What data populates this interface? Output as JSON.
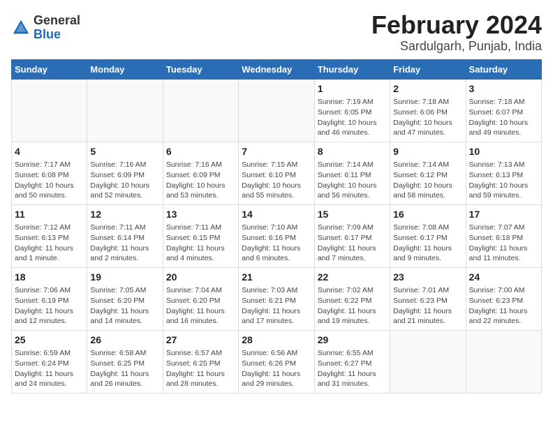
{
  "header": {
    "logo_general": "General",
    "logo_blue": "Blue",
    "title": "February 2024",
    "subtitle": "Sardulgarh, Punjab, India"
  },
  "weekdays": [
    "Sunday",
    "Monday",
    "Tuesday",
    "Wednesday",
    "Thursday",
    "Friday",
    "Saturday"
  ],
  "weeks": [
    [
      {
        "day": "",
        "info": ""
      },
      {
        "day": "",
        "info": ""
      },
      {
        "day": "",
        "info": ""
      },
      {
        "day": "",
        "info": ""
      },
      {
        "day": "1",
        "info": "Sunrise: 7:19 AM\nSunset: 6:05 PM\nDaylight: 10 hours\nand 46 minutes."
      },
      {
        "day": "2",
        "info": "Sunrise: 7:18 AM\nSunset: 6:06 PM\nDaylight: 10 hours\nand 47 minutes."
      },
      {
        "day": "3",
        "info": "Sunrise: 7:18 AM\nSunset: 6:07 PM\nDaylight: 10 hours\nand 49 minutes."
      }
    ],
    [
      {
        "day": "4",
        "info": "Sunrise: 7:17 AM\nSunset: 6:08 PM\nDaylight: 10 hours\nand 50 minutes."
      },
      {
        "day": "5",
        "info": "Sunrise: 7:16 AM\nSunset: 6:09 PM\nDaylight: 10 hours\nand 52 minutes."
      },
      {
        "day": "6",
        "info": "Sunrise: 7:16 AM\nSunset: 6:09 PM\nDaylight: 10 hours\nand 53 minutes."
      },
      {
        "day": "7",
        "info": "Sunrise: 7:15 AM\nSunset: 6:10 PM\nDaylight: 10 hours\nand 55 minutes."
      },
      {
        "day": "8",
        "info": "Sunrise: 7:14 AM\nSunset: 6:11 PM\nDaylight: 10 hours\nand 56 minutes."
      },
      {
        "day": "9",
        "info": "Sunrise: 7:14 AM\nSunset: 6:12 PM\nDaylight: 10 hours\nand 58 minutes."
      },
      {
        "day": "10",
        "info": "Sunrise: 7:13 AM\nSunset: 6:13 PM\nDaylight: 10 hours\nand 59 minutes."
      }
    ],
    [
      {
        "day": "11",
        "info": "Sunrise: 7:12 AM\nSunset: 6:13 PM\nDaylight: 11 hours\nand 1 minute."
      },
      {
        "day": "12",
        "info": "Sunrise: 7:11 AM\nSunset: 6:14 PM\nDaylight: 11 hours\nand 2 minutes."
      },
      {
        "day": "13",
        "info": "Sunrise: 7:11 AM\nSunset: 6:15 PM\nDaylight: 11 hours\nand 4 minutes."
      },
      {
        "day": "14",
        "info": "Sunrise: 7:10 AM\nSunset: 6:16 PM\nDaylight: 11 hours\nand 6 minutes."
      },
      {
        "day": "15",
        "info": "Sunrise: 7:09 AM\nSunset: 6:17 PM\nDaylight: 11 hours\nand 7 minutes."
      },
      {
        "day": "16",
        "info": "Sunrise: 7:08 AM\nSunset: 6:17 PM\nDaylight: 11 hours\nand 9 minutes."
      },
      {
        "day": "17",
        "info": "Sunrise: 7:07 AM\nSunset: 6:18 PM\nDaylight: 11 hours\nand 11 minutes."
      }
    ],
    [
      {
        "day": "18",
        "info": "Sunrise: 7:06 AM\nSunset: 6:19 PM\nDaylight: 11 hours\nand 12 minutes."
      },
      {
        "day": "19",
        "info": "Sunrise: 7:05 AM\nSunset: 6:20 PM\nDaylight: 11 hours\nand 14 minutes."
      },
      {
        "day": "20",
        "info": "Sunrise: 7:04 AM\nSunset: 6:20 PM\nDaylight: 11 hours\nand 16 minutes."
      },
      {
        "day": "21",
        "info": "Sunrise: 7:03 AM\nSunset: 6:21 PM\nDaylight: 11 hours\nand 17 minutes."
      },
      {
        "day": "22",
        "info": "Sunrise: 7:02 AM\nSunset: 6:22 PM\nDaylight: 11 hours\nand 19 minutes."
      },
      {
        "day": "23",
        "info": "Sunrise: 7:01 AM\nSunset: 6:23 PM\nDaylight: 11 hours\nand 21 minutes."
      },
      {
        "day": "24",
        "info": "Sunrise: 7:00 AM\nSunset: 6:23 PM\nDaylight: 11 hours\nand 22 minutes."
      }
    ],
    [
      {
        "day": "25",
        "info": "Sunrise: 6:59 AM\nSunset: 6:24 PM\nDaylight: 11 hours\nand 24 minutes."
      },
      {
        "day": "26",
        "info": "Sunrise: 6:58 AM\nSunset: 6:25 PM\nDaylight: 11 hours\nand 26 minutes."
      },
      {
        "day": "27",
        "info": "Sunrise: 6:57 AM\nSunset: 6:25 PM\nDaylight: 11 hours\nand 28 minutes."
      },
      {
        "day": "28",
        "info": "Sunrise: 6:56 AM\nSunset: 6:26 PM\nDaylight: 11 hours\nand 29 minutes."
      },
      {
        "day": "29",
        "info": "Sunrise: 6:55 AM\nSunset: 6:27 PM\nDaylight: 11 hours\nand 31 minutes."
      },
      {
        "day": "",
        "info": ""
      },
      {
        "day": "",
        "info": ""
      }
    ]
  ]
}
